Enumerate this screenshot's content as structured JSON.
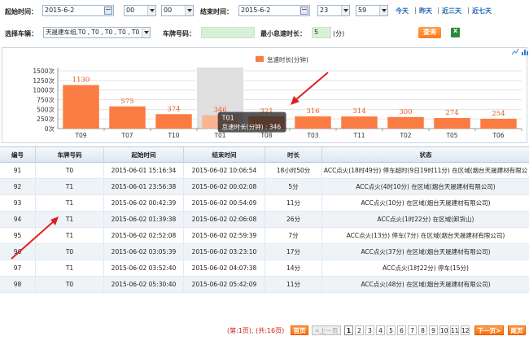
{
  "filters": {
    "start_label": "起始时间：",
    "start_date": "2015-6-2",
    "start_hour": "00",
    "start_min": "00",
    "end_label": "结束时间：",
    "end_date": "2015-6-2",
    "end_hour": "23",
    "end_min": "59",
    "quick": [
      "今天",
      "昨天",
      "近三天",
      "近七天"
    ],
    "vehicle_label": "选择车辆：",
    "vehicle_value": "天晟建车组,T0  , T0  , T0  , T0  , T0",
    "plate_label": "车牌号码：",
    "plate_value": "",
    "min_label": "最小怠速时长：",
    "min_value": "5",
    "min_unit": "(分)",
    "query_button": "查询"
  },
  "chart_data": {
    "type": "bar",
    "legend": "怠速时长(分钟)",
    "legend_position": "top-right",
    "categories": [
      "T09",
      "T07",
      "T10",
      "T01",
      "T08",
      "T03",
      "T11",
      "T02",
      "T05",
      "T06"
    ],
    "values": [
      1130,
      575,
      374,
      346,
      321,
      316,
      314,
      300,
      274,
      254
    ],
    "yticks": [
      "1500次",
      "1250次",
      "1000次",
      "750次",
      "500次",
      "250次",
      "0次"
    ],
    "ylim": [
      0,
      1500
    ],
    "bar_color": "#fb7c42",
    "highlight_index": 3,
    "tooltip": {
      "title": "T01",
      "text": "怠速时长(分钟) : 346"
    }
  },
  "table": {
    "headers": [
      "编号",
      "车牌号码",
      "起始时间",
      "结束时间",
      "时长",
      "状态"
    ],
    "rows": [
      [
        "91",
        "T0",
        "2015-06-01 15:16:34",
        "2015-06-02 10:06:54",
        "18小时50分",
        "ACC点火(18时49分) 停车超时(9日19时11分) 在区域(烟台天晟建材有限公"
      ],
      [
        "92",
        "T1",
        "2015-06-01 23:56:38",
        "2015-06-02 00:02:08",
        "5分",
        "ACC点火(4时10分) 在区域(烟台天晟建材有限公司)"
      ],
      [
        "93",
        "T1",
        "2015-06-02 00:42:39",
        "2015-06-02 00:54:09",
        "11分",
        "ACC点火(10分) 在区域(烟台天晟建材有限公司)"
      ],
      [
        "94",
        "T1",
        "2015-06-02 01:39:38",
        "2015-06-02 02:06:08",
        "26分",
        "ACC点火(1时22分) 在区域(卸货山)"
      ],
      [
        "95",
        "T1",
        "2015-06-02 02:52:08",
        "2015-06-02 02:59:39",
        "7分",
        "ACC点火(13分) 停车(7分) 在区域(烟台天晟建材有限公司)"
      ],
      [
        "96",
        "T0",
        "2015-06-02 03:05:39",
        "2015-06-02 03:23:10",
        "17分",
        "ACC点火(37分) 在区域(烟台天晟建材有限公司)"
      ],
      [
        "97",
        "T1",
        "2015-06-02 03:52:40",
        "2015-06-02 04:07:38",
        "14分",
        "ACC点火(1时22分) 停车(15分)"
      ],
      [
        "98",
        "T0",
        "2015-06-02 05:30:40",
        "2015-06-02 05:42:09",
        "11分",
        "ACC点火(48分) 在区域(烟台天晟建材有限公司)"
      ]
    ]
  },
  "pager": {
    "info": "(第:1页), (共:16页)",
    "first": "首页",
    "prev": "<上一页",
    "pages": [
      "1",
      "2",
      "3",
      "4",
      "5",
      "6",
      "7",
      "8",
      "9",
      "10",
      "11",
      "12"
    ],
    "next": "下一页>",
    "last": "尾页"
  }
}
